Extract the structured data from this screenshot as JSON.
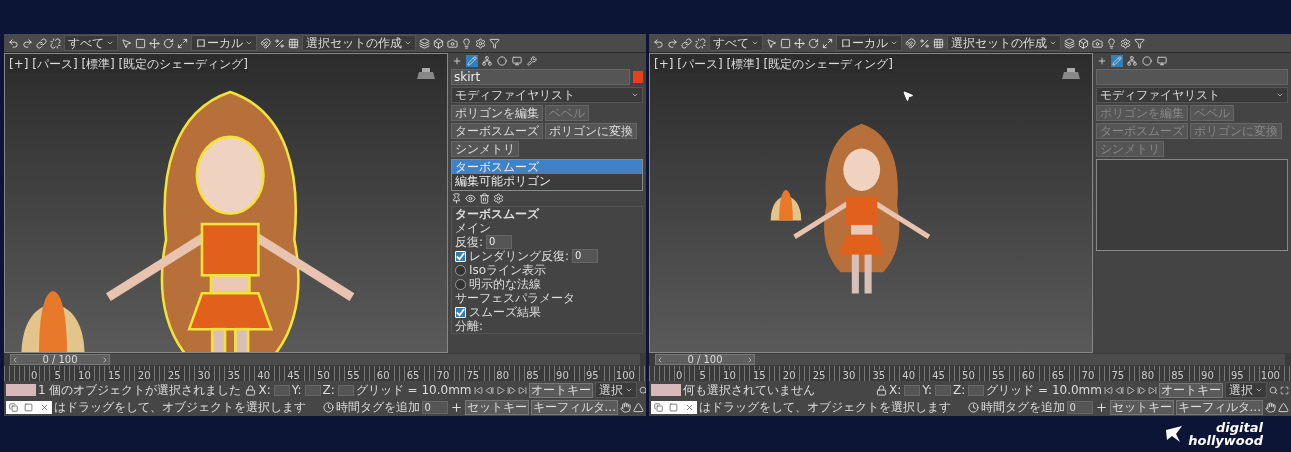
{
  "windows": [
    {
      "toolbar": {
        "dropdowns": [
          "すべて",
          "ローカル",
          "選択セットの作成"
        ]
      },
      "viewport": {
        "label": "[+] [パース] [標準] [既定のシェーディング]",
        "model_selected": true,
        "cursor": false
      },
      "command_panel": {
        "tabs": [
          {
            "kind": "create",
            "selected": false
          },
          {
            "kind": "modify",
            "selected": true
          },
          {
            "kind": "hierarchy",
            "selected": false
          },
          {
            "kind": "motion",
            "selected": false
          },
          {
            "kind": "display",
            "selected": false
          },
          {
            "kind": "utilities",
            "selected": false
          }
        ],
        "object_name": "skirt",
        "modifier_list": "モディファイヤリスト",
        "buttons": [
          {
            "label": "ポリゴンを編集",
            "disabled": false
          },
          {
            "label": "ベベル",
            "disabled": true
          },
          {
            "label": "ターボスムーズ",
            "disabled": false
          },
          {
            "label": "ポリゴンに変換",
            "disabled": false
          },
          {
            "label": "シンメトリ",
            "disabled": false
          }
        ],
        "stack": [
          {
            "label": "ターボスムーズ",
            "selected": true
          },
          {
            "label": "編集可能ポリゴン",
            "selected": false
          }
        ],
        "rollout": {
          "title": "ターボスムーズ",
          "section": "メイン",
          "spinners": [
            {
              "label": "反復:",
              "value": "0"
            },
            {
              "label": "レンダリング反復:",
              "value": "0",
              "checked": true
            }
          ],
          "options": [
            {
              "label": "Isoライン表示",
              "checked": false
            },
            {
              "label": "明示的な法線",
              "checked": false
            }
          ],
          "group": "サーフェスパラメータ",
          "group_options": [
            {
              "label": "スムーズ結果",
              "checked": true
            }
          ],
          "tail": "分離:"
        }
      },
      "timeline": {
        "position": "0 / 100",
        "level": 0,
        "ticks": [
          "0",
          "5",
          "10",
          "15",
          "20",
          "25",
          "30",
          "35",
          "40",
          "45",
          "50",
          "55",
          "60",
          "65",
          "70",
          "75",
          "80",
          "85",
          "90",
          "95",
          "100"
        ]
      },
      "status": {
        "message": "1 個のオブジェクトが選択されました",
        "prompt": "はドラッグをして、オブジェクトを選択します",
        "coords": [
          "X:",
          "Y:",
          "Z:"
        ],
        "grid": "グリッド = 10.0mm",
        "time_tag": "時間タグを追加",
        "frame": "0",
        "auto_key": "オートキー",
        "key_mode": "選択",
        "set_key": "セットキー",
        "key_filter": "キーフィルタ..."
      }
    },
    {
      "toolbar": {
        "dropdowns": [
          "すべて",
          "ローカル",
          "選択セットの作成"
        ]
      },
      "viewport": {
        "label": "[+] [パース] [標準] [既定のシェーディング]",
        "model_selected": false,
        "cursor": true
      },
      "command_panel": {
        "tabs": [
          {
            "kind": "create",
            "selected": false
          },
          {
            "kind": "modify",
            "selected": true
          },
          {
            "kind": "hierarchy",
            "selected": false
          },
          {
            "kind": "motion",
            "selected": false
          },
          {
            "kind": "display",
            "selected": false
          }
        ],
        "modifier_list": "モディファイヤリスト",
        "buttons": [
          {
            "label": "ポリゴンを編集",
            "disabled": true
          },
          {
            "label": "ベベル",
            "disabled": true
          },
          {
            "label": "ターボスムーズ",
            "disabled": true
          },
          {
            "label": "ポリゴンに変換",
            "disabled": true
          },
          {
            "label": "シンメトリ",
            "disabled": true
          }
        ]
      },
      "timeline": {
        "position": "0 / 100",
        "level": 0,
        "ticks": [
          "0",
          "5",
          "10",
          "15",
          "20",
          "25",
          "30",
          "35",
          "40",
          "45",
          "50",
          "55",
          "60",
          "65",
          "70",
          "75",
          "80",
          "85",
          "90",
          "95",
          "100"
        ]
      },
      "status": {
        "message": "何も選択されていません",
        "prompt": "はドラッグをして、オブジェクトを選択します",
        "coords": [
          "X:",
          "Y:",
          "Z:"
        ],
        "grid": "グリッド = 10.0mm",
        "time_tag": "時間タグを追加",
        "frame": "0",
        "auto_key": "オートキー",
        "key_mode": "選択",
        "set_key": "セットキー",
        "key_filter": "キーフィルタ..."
      }
    }
  ],
  "logo": {
    "lines": [
      "digital",
      "hollywood"
    ]
  }
}
